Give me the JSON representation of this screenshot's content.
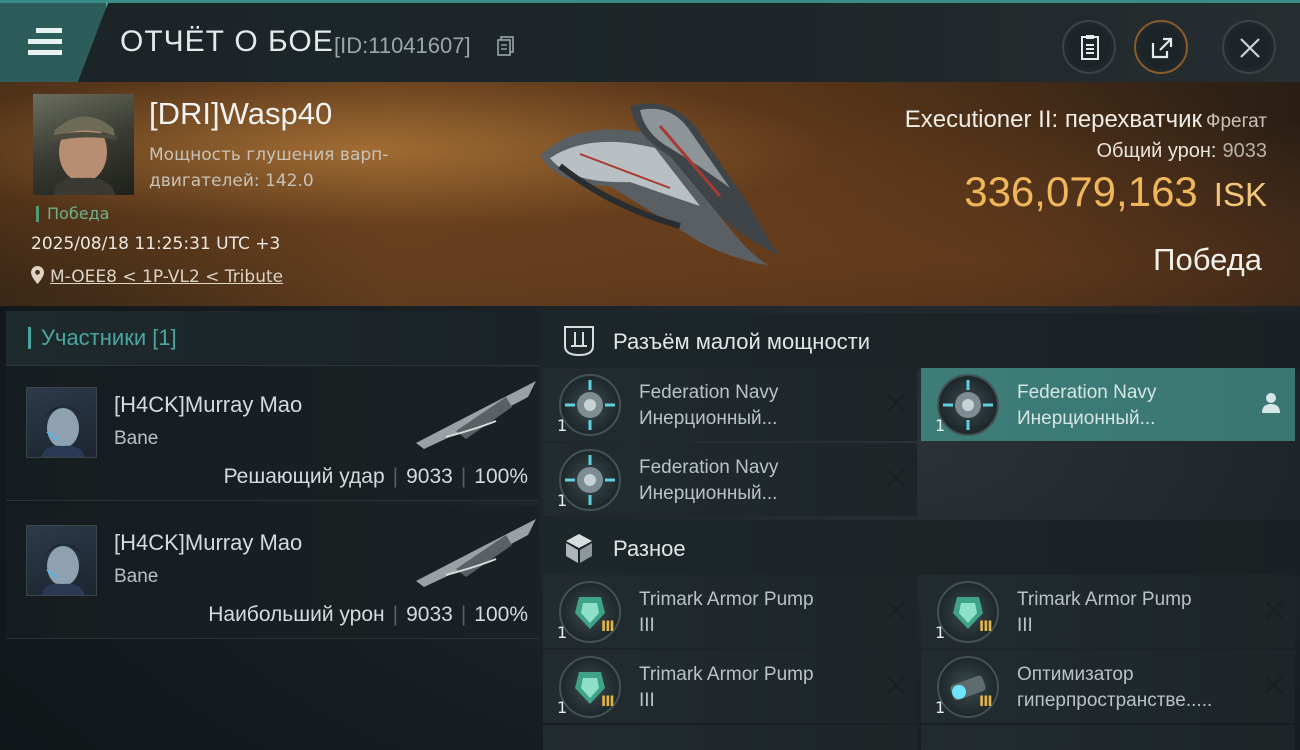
{
  "header": {
    "title": "ОТЧЁТ О БОЕ",
    "report_id": "[ID:11041607]"
  },
  "victim": {
    "name": "[DRI]Wasp40",
    "warp_disruption": "Мощность глушения варп-двигателей: 142.0",
    "result_small": "Победа",
    "datetime": "2025/08/18 11:25:31 UTC +3",
    "location": "M-OEE8 < 1P-VL2 < Tribute",
    "ship_name": "Executioner II: перехватчик",
    "ship_class": "Фрегат",
    "total_damage_label": "Общий урон:",
    "total_damage_value": "9033",
    "isk_value": "336,079,163",
    "isk_currency": "ISK",
    "result_big": "Победа"
  },
  "participants": {
    "title": "Участники [1]",
    "cards": [
      {
        "name": "[H4CK]Murray Mao",
        "ship": "Bane",
        "role": "Решающий удар",
        "damage": "9033",
        "percent": "100%"
      },
      {
        "name": "[H4CK]Murray Mao",
        "ship": "Bane",
        "role": "Наибольший урон",
        "damage": "9033",
        "percent": "100%"
      }
    ]
  },
  "sections": {
    "low_slot": {
      "title": "Разъём малой мощности",
      "items": [
        {
          "line1": "Federation Navy",
          "line2": "Инерционный...",
          "qty": "1"
        },
        {
          "line1": "Federation Navy",
          "line2": "Инерционный...",
          "qty": "1"
        },
        {
          "line1": "Federation Navy",
          "line2": "Инерционный...",
          "qty": "1"
        }
      ]
    },
    "misc": {
      "title": "Разное",
      "items": [
        {
          "line1": "Trimark Armor Pump",
          "line2": "III",
          "qty": "1",
          "tier": "III"
        },
        {
          "line1": "Trimark Armor Pump",
          "line2": "III",
          "qty": "1",
          "tier": "III"
        },
        {
          "line1": "Trimark Armor Pump",
          "line2": "III",
          "qty": "1",
          "tier": "III"
        },
        {
          "line1": "Оптимизатор",
          "line2": "гиперпространстве.....",
          "qty": "1",
          "tier": "III"
        }
      ]
    }
  },
  "colors": {
    "accent_teal": "#4aa6a0",
    "isk_gold": "#f0b65a",
    "active_card": "#3e7d78"
  }
}
